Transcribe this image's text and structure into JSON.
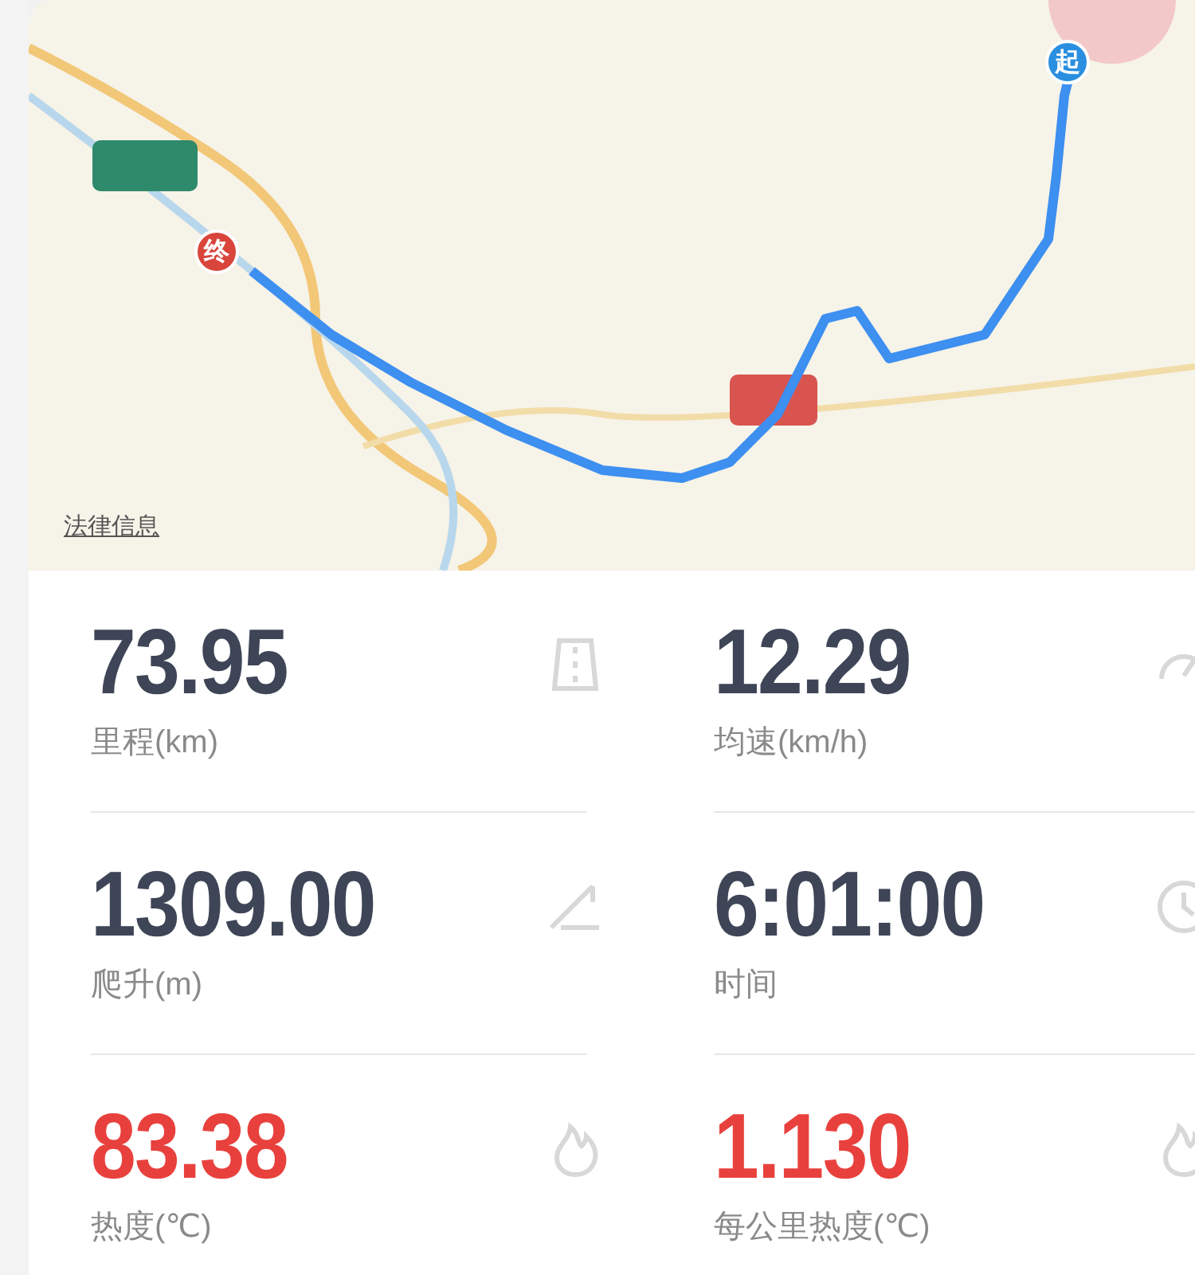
{
  "map": {
    "start_marker": "起",
    "end_marker": "终",
    "legal_link": "法律信息"
  },
  "stats": [
    {
      "value": "73.95",
      "label": "里程(km)",
      "kind": "normal"
    },
    {
      "value": "12.29",
      "label": "均速(km/h)",
      "kind": "normal"
    },
    {
      "value": "1309.00",
      "label": "爬升(m)",
      "kind": "normal"
    },
    {
      "value": "6:01:00",
      "label": "时间",
      "kind": "normal"
    },
    {
      "value": "83.38",
      "label": "热度(℃)",
      "kind": "heat"
    },
    {
      "value": "1.130",
      "label": "每公里热度(℃)",
      "kind": "heat"
    }
  ]
}
